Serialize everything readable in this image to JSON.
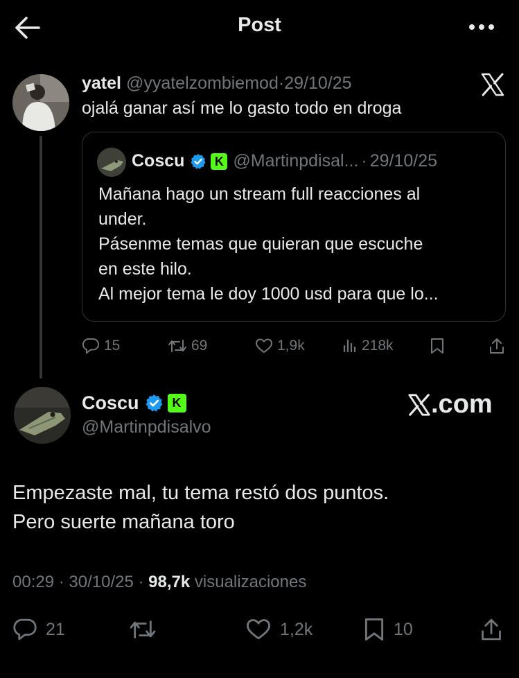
{
  "header": {
    "title": "Post"
  },
  "parent": {
    "name": "yatel",
    "handle": "@yyatelzombiemod",
    "separator": "·",
    "date": "29/10/25",
    "text": "ojalá ganar así me lo gasto todo en droga",
    "quote": {
      "name": "Coscu",
      "badge_letter": "K",
      "handle": "@Martinpdisal...",
      "separator": "·",
      "date": "29/10/25",
      "lines": [
        "Mañana hago un stream full reacciones al",
        "under.",
        "Pásenme temas que quieran que escuche",
        "en este hilo.",
        "Al mejor tema le doy 1000 usd para que lo..."
      ]
    },
    "actions": {
      "replies": "15",
      "reposts": "69",
      "likes": "1,9k",
      "views": "218k"
    }
  },
  "main": {
    "name": "Coscu",
    "badge_letter": "K",
    "handle": "@Martinpdisalvo",
    "watermark_suffix": ".com",
    "lines": [
      "Empezaste mal, tu tema restó dos puntos.",
      "Pero suerte mañana toro"
    ],
    "meta": {
      "time": "00:29",
      "sep1": "·",
      "date": "30/10/25",
      "sep2": "·",
      "views": "98,7k",
      "views_label": "visualizaciones"
    },
    "actions": {
      "replies": "21",
      "likes": "1,2k",
      "bookmarks": "10"
    }
  },
  "colors": {
    "background": "#000000",
    "text": "#e7e9ea",
    "muted": "#71767b",
    "verified": "#1d9bf0",
    "kick": "#53fc18",
    "border": "#2f3336"
  },
  "icons": [
    "back-arrow-icon",
    "more-icon",
    "x-logo-icon",
    "verified-icon",
    "kick-badge-icon",
    "reply-icon",
    "repost-icon",
    "like-icon",
    "views-icon",
    "bookmark-icon",
    "share-icon"
  ]
}
